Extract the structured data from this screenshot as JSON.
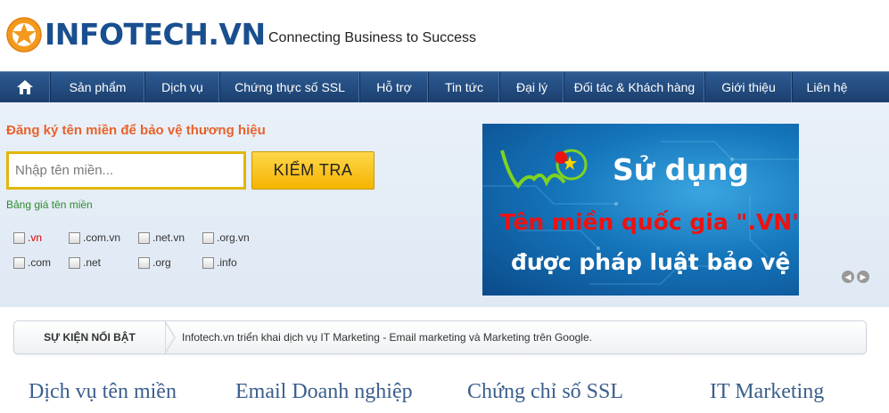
{
  "header": {
    "logo_text": "INFOTECH.VN",
    "tagline": "Connecting Business to Success"
  },
  "nav": {
    "home_icon": "home-icon",
    "items": [
      {
        "label": "Sản phẩm"
      },
      {
        "label": "Dịch vụ"
      },
      {
        "label": "Chứng thực số SSL"
      },
      {
        "label": "Hỗ trợ"
      },
      {
        "label": "Tin tức"
      },
      {
        "label": "Đại lý"
      },
      {
        "label": "Đối tác & Khách hàng"
      },
      {
        "label": "Giới thiệu"
      },
      {
        "label": "Liên hệ"
      }
    ]
  },
  "domain_search": {
    "title": "Đăng ký tên miền để bảo vệ thương hiệu",
    "placeholder": "Nhập tên miền...",
    "button_label": "KIỂM TRA",
    "price_link": "Bảng giá tên miền",
    "tlds": [
      ".vn",
      ".com.vn",
      ".net.vn",
      ".org.vn",
      ".com",
      ".net",
      ".org",
      ".info"
    ]
  },
  "promo": {
    "line1": "Sử dụng",
    "line2": "Tên miền quốc gia \".VN\"",
    "line3": "được pháp luật bảo vệ"
  },
  "event": {
    "label": "SỰ KIỆN NỔI BẬT",
    "text": "Infotech.vn triển khai dịch vụ IT Marketing - Email marketing và Marketing trên Google."
  },
  "services": [
    "Dịch vụ tên miền",
    "Email Doanh nghiệp",
    "Chứng chỉ số SSL",
    "IT Marketing"
  ],
  "colors": {
    "nav_bg": "#1b3f6e",
    "accent_orange": "#e8622a",
    "button_yellow": "#f5b400",
    "link_green": "#2e8b2e"
  }
}
